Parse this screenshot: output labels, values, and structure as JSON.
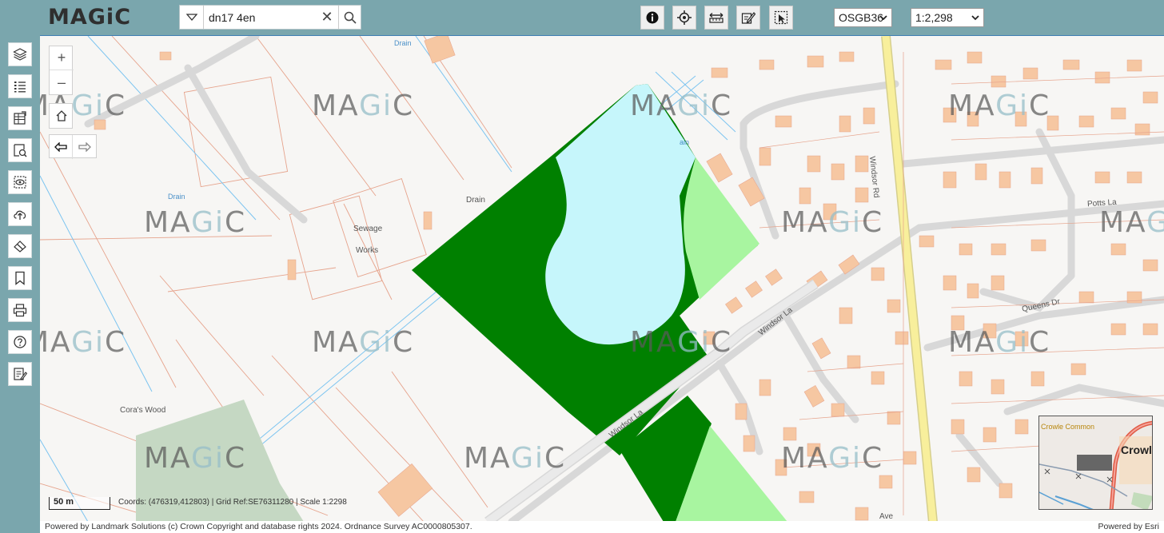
{
  "app": {
    "logo_text_a": "MA",
    "logo_text_gi": "Gi",
    "logo_text_c": "C"
  },
  "search": {
    "value": "dn17 4en",
    "clear_symbol": "✕"
  },
  "toolbar": {
    "icons": [
      "info-icon",
      "locate-icon",
      "measure-icon",
      "draw-icon",
      "select-icon"
    ]
  },
  "projection": {
    "selected": "OSGB36"
  },
  "scale": {
    "selected": "1:2,298"
  },
  "sidebar": {
    "icons": [
      "layers-icon",
      "legend-icon",
      "table-icon",
      "identify-icon",
      "view-icon",
      "upload-icon",
      "eraser-icon",
      "bookmark-icon",
      "print-icon",
      "help-icon",
      "report-icon"
    ]
  },
  "map": {
    "zoom_in": "+",
    "zoom_out": "–",
    "labels": {
      "drain_top": "Drain",
      "drain_left": "Drain",
      "drain_mid": "Drain",
      "drain_right": "ain",
      "sewage": "Sewage",
      "works": "Works",
      "coras_wood": "Cora's Wood",
      "windsor_rd": "Windsor Rd",
      "potts_la": "Potts La",
      "queens_dr": "Queens Dr",
      "windsor_la_upper": "Windsor La",
      "windsor_la_lower": "Windsor La",
      "ave": "Ave"
    },
    "watermark_a": "MA",
    "watermark_gi": "Gi",
    "watermark_c": "C",
    "scalebar": "50 m",
    "coords": "Coords: (476319,412803) | Grid Ref:SE76311280 | Scale 1:2298"
  },
  "overview": {
    "crowle_common": "Crowle Common",
    "crowle": "Crowl"
  },
  "footer": {
    "attribution": "Powered by Landmark Solutions (c) Crown Copyright and database rights 2024. Ordnance Survey AC0000805307.",
    "powered": "Powered by Esri"
  },
  "colors": {
    "dark_green": "#008000",
    "light_cyan": "#c6f6fb",
    "light_green": "#a8f5a0",
    "building": "#f6c7a2",
    "plot_line": "#e6a38c",
    "road_major": "#f8ef9c",
    "water": "#7cc4f0"
  }
}
